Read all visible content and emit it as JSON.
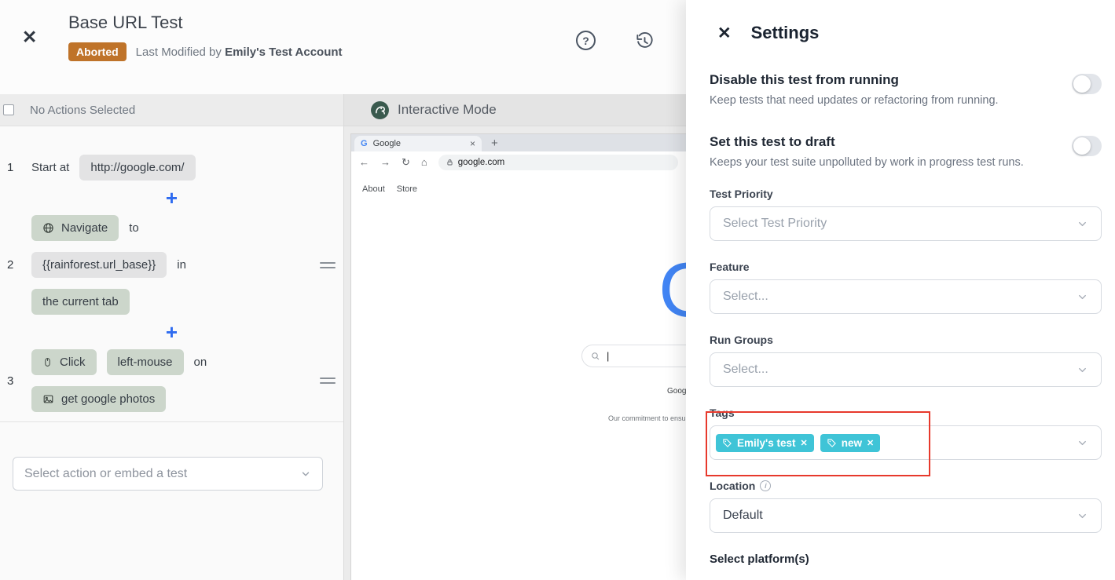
{
  "header": {
    "title": "Base URL Test",
    "status_badge": "Aborted",
    "modified_prefix": "Last Modified by",
    "modified_by": "Emily's Test Account"
  },
  "steps_panel": {
    "selection_bar_label": "No Actions Selected",
    "step1": {
      "number": "1",
      "prefix": "Start at",
      "url_pill": "http://google.com/"
    },
    "step2": {
      "number": "2",
      "action_pill": "Navigate",
      "to_word": "to",
      "target_pill": "{{rainforest.url_base}}",
      "in_word": "in",
      "tab_pill": "the current tab"
    },
    "step3": {
      "number": "3",
      "action_pill": "Click",
      "mouse_pill": "left-mouse",
      "on_word": "on",
      "target_pill": "get google photos"
    },
    "add_action_placeholder": "Select action or embed a test"
  },
  "interactive_mode": {
    "title": "Interactive Mode",
    "browser": {
      "tab_title": "Google",
      "favicon_letter": "G",
      "url": "google.com",
      "link_about": "About",
      "link_store": "Store",
      "logo_fragment": "G",
      "search_button_fragment": "Goog",
      "footer_fragment": "Our commitment to ensu"
    }
  },
  "settings": {
    "title": "Settings",
    "disable_toggle": {
      "title": "Disable this test from running",
      "description": "Keep tests that need updates or refactoring from running.",
      "state": "off"
    },
    "draft_toggle": {
      "title": "Set this test to draft",
      "description": "Keeps your test suite unpolluted by work in progress test runs.",
      "state": "off"
    },
    "test_priority": {
      "label": "Test Priority",
      "placeholder": "Select Test Priority"
    },
    "feature": {
      "label": "Feature",
      "placeholder": "Select..."
    },
    "run_groups": {
      "label": "Run Groups",
      "placeholder": "Select..."
    },
    "tags": {
      "label": "Tags",
      "chips": [
        {
          "label": "Emily's test"
        },
        {
          "label": "new"
        }
      ]
    },
    "location": {
      "label": "Location",
      "value": "Default"
    },
    "platforms_label": "Select platform(s)"
  },
  "icons": {
    "close_x": "✕",
    "question_mark": "?",
    "plus": "+",
    "back_arrow": "←",
    "forward_arrow": "→",
    "refresh": "↻",
    "home": "⌂",
    "new_tab_plus": "+",
    "tab_close": "×",
    "chip_remove": "✕",
    "text_cursor": "|",
    "info_i": "i"
  },
  "colors": {
    "badge_bg": "#bf7329",
    "tag_chip_bg": "#3fc4d7",
    "accent_blue": "#2e6bf0",
    "google_blue": "#4285f4",
    "annotation_red": "#e7392c"
  }
}
